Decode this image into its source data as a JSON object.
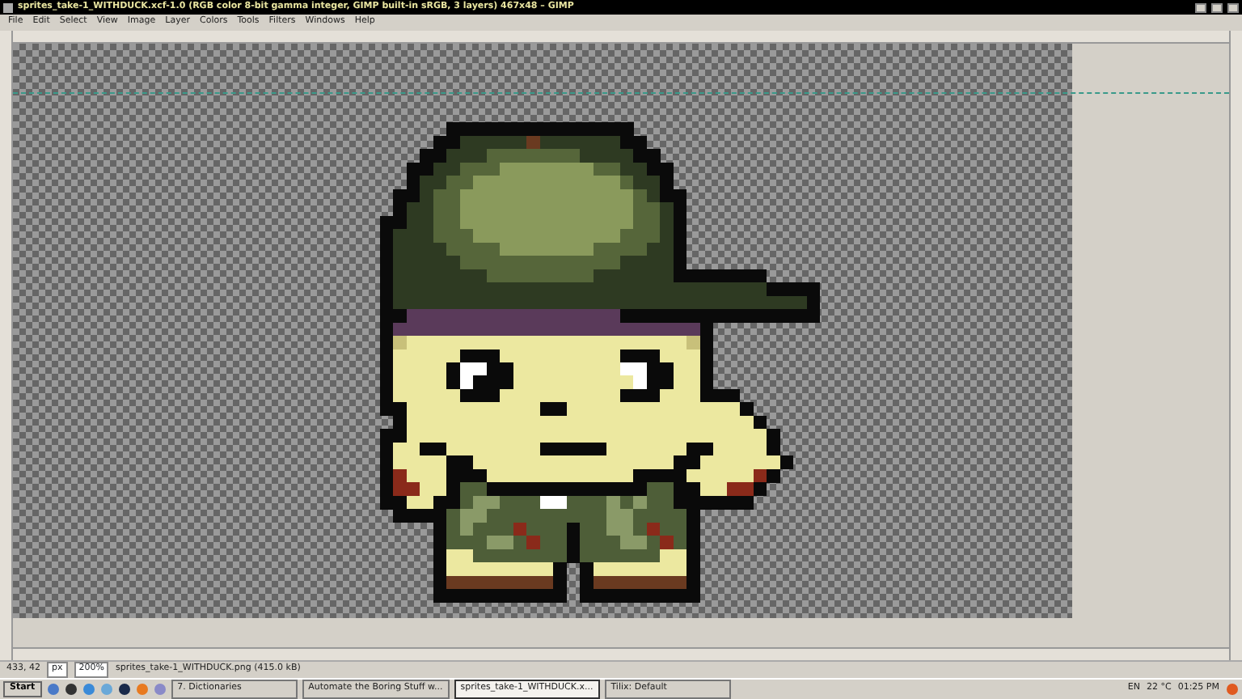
{
  "window": {
    "title": "sprites_take-1_WITHDUCK.xcf-1.0 (RGB color 8-bit gamma integer, GIMP built-in sRGB, 3 layers) 467x48 – GIMP"
  },
  "menu": [
    "File",
    "Edit",
    "Select",
    "View",
    "Image",
    "Layer",
    "Colors",
    "Tools",
    "Filters",
    "Windows",
    "Help"
  ],
  "status_bar": {
    "coordinates": "433, 42",
    "unit": "px",
    "zoom": "200%",
    "file_info": "sprites_take-1_WITHDUCK.png (415.0 kB)"
  },
  "taskbar": {
    "start": "Start",
    "tasks": [
      {
        "label": "7. Dictionaries",
        "selected": false
      },
      {
        "label": "Automate the Boring Stuff w...",
        "selected": false
      },
      {
        "label": "sprites_take-1_WITHDUCK.x...",
        "selected": true
      },
      {
        "label": "Tilix: Default",
        "selected": false
      }
    ],
    "tray": {
      "language": "EN",
      "temperature": "22 °C",
      "clock": "01:25 PM"
    }
  }
}
